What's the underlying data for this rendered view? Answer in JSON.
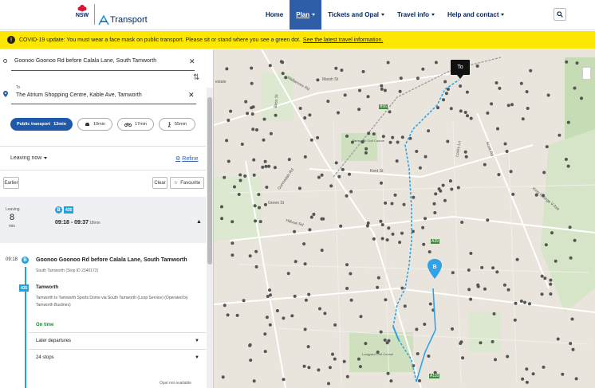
{
  "header": {
    "logo_nsw": "NSW",
    "logo_transport": "Transport",
    "nav": [
      {
        "label": "Home",
        "active": false,
        "dropdown": false
      },
      {
        "label": "Plan",
        "active": true,
        "dropdown": true
      },
      {
        "label": "Tickets and Opal",
        "active": false,
        "dropdown": true
      },
      {
        "label": "Travel info",
        "active": false,
        "dropdown": true
      },
      {
        "label": "Help and contact",
        "active": false,
        "dropdown": true
      }
    ]
  },
  "banner": {
    "text": "COVID-19 update: You must wear a face mask on public transport. Please sit or stand where you see a green dot.",
    "link": "See the latest travel information."
  },
  "planner": {
    "from": "Goonoo Goonoo Rd before Calala Lane, South Tamworth",
    "to_label": "To",
    "to": "The Atrium Shopping Centre, Kable Ave, Tamworth",
    "modes": [
      {
        "label": "Public transport",
        "time": "13min",
        "active": true,
        "icon": "public-transport"
      },
      {
        "label": "",
        "time": "10min",
        "active": false,
        "icon": "car-icon"
      },
      {
        "label": "",
        "time": "17min",
        "active": false,
        "icon": "bike-icon"
      },
      {
        "label": "",
        "time": "55min",
        "active": false,
        "icon": "walk-icon"
      }
    ],
    "leaving": "Leaving now",
    "refine": "Refine",
    "earlier": "Earlier",
    "clear": "Clear",
    "favourite": "Favourite"
  },
  "trip": {
    "leaving_label": "Leaving",
    "leaving_num": "8",
    "leaving_unit": "min",
    "route": "435",
    "times": "09:18 - 09:37",
    "duration": "18min"
  },
  "detail": {
    "time": "09:18",
    "stop": "Goonoo Goonoo Rd before Calala Lane, South Tamworth",
    "stop_sub": "South Tamworth (Stop ID 2340172)",
    "route": "435",
    "route_name": "Tamworth",
    "route_desc": "Tamworth to Tamworth Sports Dome via South Tamworth (Loop Service) (Operated by Tamworth Buslines)",
    "on_time": "On time",
    "later_departures": "Later departures",
    "stops": "24 stops",
    "opal": "Opal not available"
  },
  "map": {
    "to_marker": "To",
    "labels": {
      "wallamore": "Wallamore Rd",
      "marsh": "Marsh St",
      "kent": "Kent St",
      "scott": "Scott Rd",
      "locks": "Locks Ln",
      "bass": "Bass St",
      "gunnedah": "Gunnedah Rd",
      "hillvue": "Hillvue Rd",
      "green": "Green St",
      "tamworth_golf": "Tamworth Golf Course",
      "longyard": "Longyard Golf Course",
      "estate": "estate",
      "a39": "A39",
      "a110": "A110",
      "b56": "B56",
      "kingsgeorge": "King George V Ave"
    }
  }
}
